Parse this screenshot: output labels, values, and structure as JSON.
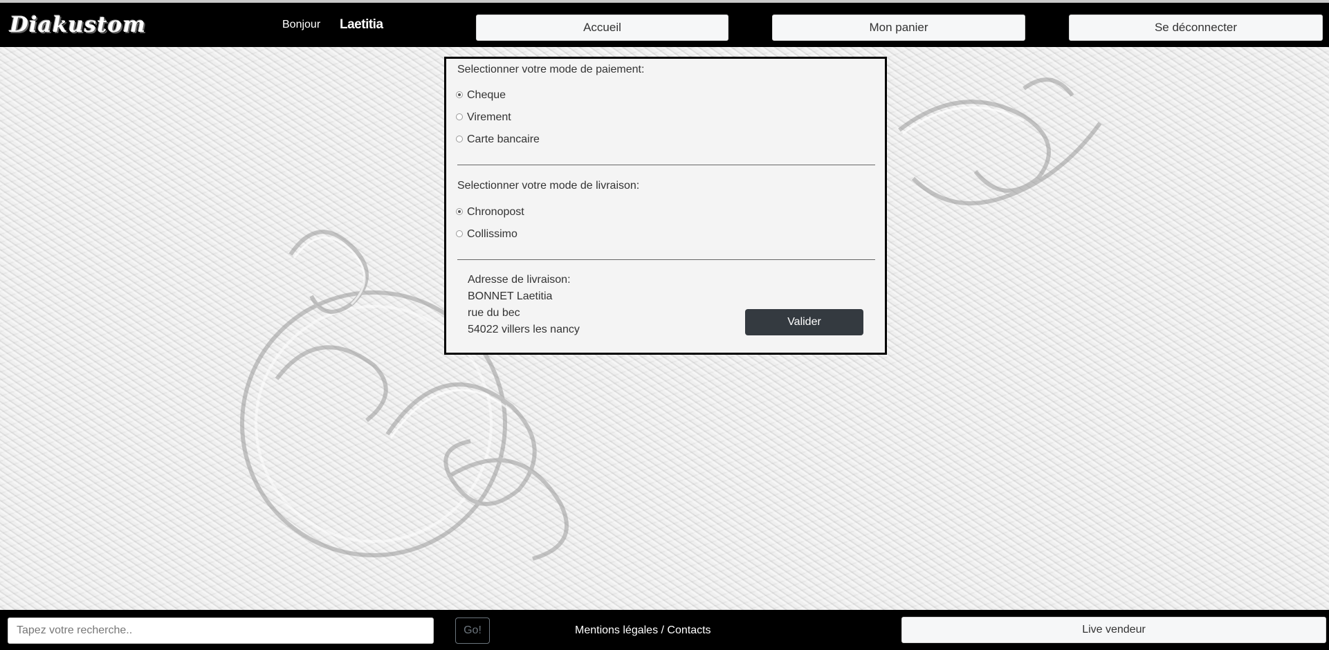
{
  "header": {
    "logo_text": "Diakustom",
    "greeting": "Bonjour",
    "username": "Laetitia",
    "nav": {
      "home": "Accueil",
      "cart": "Mon panier",
      "logout": "Se déconnecter"
    }
  },
  "payment": {
    "title": "Selectionner votre mode de paiement:",
    "options": [
      {
        "label": "Cheque",
        "selected": true
      },
      {
        "label": "Virement",
        "selected": false
      },
      {
        "label": "Carte bancaire",
        "selected": false
      }
    ]
  },
  "delivery": {
    "title": "Selectionner votre mode de livraison:",
    "options": [
      {
        "label": "Chronopost",
        "selected": true
      },
      {
        "label": "Collissimo",
        "selected": false
      }
    ]
  },
  "address": {
    "title": "Adresse de livraison:",
    "name": "BONNET Laetitia",
    "street": "rue du bec",
    "city": "54022 villers les nancy"
  },
  "submit_label": "Valider",
  "footer": {
    "search_placeholder": "Tapez votre recherche..",
    "go_label": "Go!",
    "legal_link": "Mentions légales / Contacts",
    "live_button": "Live vendeur"
  },
  "colors": {
    "header_bg": "#000000",
    "dark_button": "#343a40",
    "panel_bg": "#f4f4f4"
  }
}
